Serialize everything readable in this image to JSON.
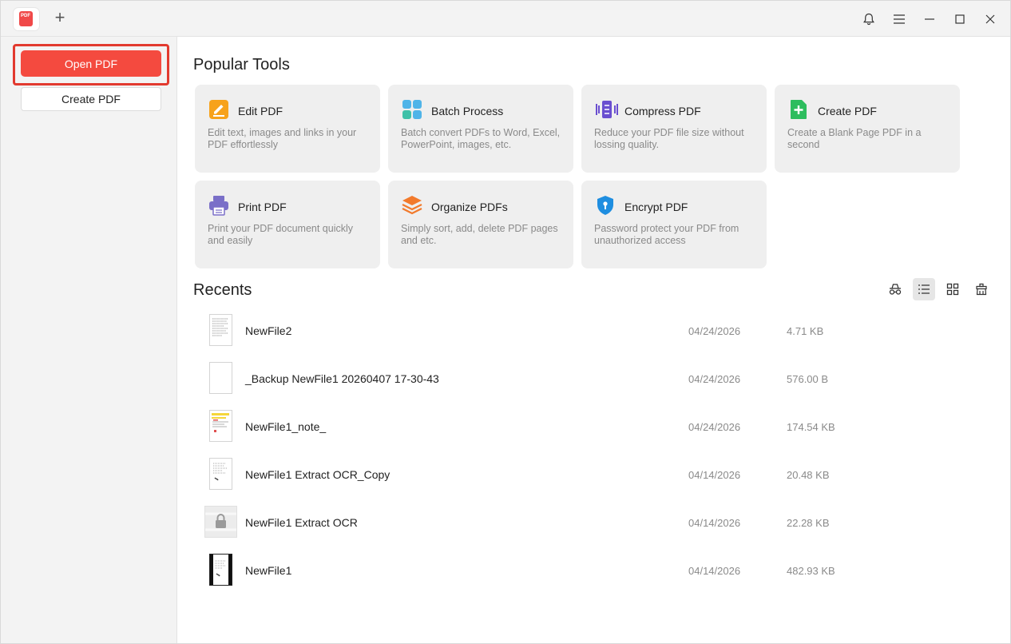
{
  "app": {
    "logo_text": "PDF",
    "new_tab_symbol": "+"
  },
  "titlebar": {
    "icons": [
      "bell-icon",
      "menu-icon",
      "minimize-icon",
      "maximize-icon",
      "close-icon"
    ]
  },
  "sidebar": {
    "open_label": "Open PDF",
    "create_label": "Create PDF"
  },
  "popular": {
    "title": "Popular Tools",
    "tools": [
      {
        "title": "Edit PDF",
        "desc": "Edit text, images and links in your PDF effortlessly",
        "icon": "edit-pdf-icon"
      },
      {
        "title": "Batch Process",
        "desc": "Batch convert PDFs to Word, Excel, PowerPoint, images, etc.",
        "icon": "batch-process-icon"
      },
      {
        "title": "Compress PDF",
        "desc": "Reduce your PDF file size without lossing quality.",
        "icon": "compress-pdf-icon"
      },
      {
        "title": "Create PDF",
        "desc": "Create a Blank Page PDF in a second",
        "icon": "create-pdf-icon"
      },
      {
        "title": "Print PDF",
        "desc": "Print your PDF document quickly and easily",
        "icon": "print-pdf-icon"
      },
      {
        "title": "Organize PDFs",
        "desc": "Simply sort, add, delete PDF pages and etc.",
        "icon": "organize-pdfs-icon"
      },
      {
        "title": "Encrypt PDF",
        "desc": "Password protect your PDF from unauthorized access",
        "icon": "encrypt-pdf-icon"
      }
    ]
  },
  "recents": {
    "title": "Recents",
    "view_icons": [
      "incognito-icon",
      "list-view-icon",
      "grid-view-icon",
      "clear-recents-icon"
    ],
    "active_view": "list",
    "files": [
      {
        "name": "NewFile2",
        "date": "04/24/2026",
        "size": "4.71 KB",
        "thumb": "text"
      },
      {
        "name": "_Backup NewFile1 20260407 17-30-43",
        "date": "04/24/2026",
        "size": "576.00 B",
        "thumb": "blank"
      },
      {
        "name": "NewFile1_note_",
        "date": "04/24/2026",
        "size": "174.54 KB",
        "thumb": "notes"
      },
      {
        "name": "NewFile1 Extract OCR_Copy",
        "date": "04/14/2026",
        "size": "20.48 KB",
        "thumb": "scan"
      },
      {
        "name": "NewFile1 Extract OCR",
        "date": "04/14/2026",
        "size": "22.28 KB",
        "thumb": "locked"
      },
      {
        "name": "NewFile1",
        "date": "04/14/2026",
        "size": "482.93 KB",
        "thumb": "scan-dark"
      }
    ]
  },
  "colors": {
    "accent": "#f44a3f",
    "highlight_border": "#e23a2f"
  }
}
